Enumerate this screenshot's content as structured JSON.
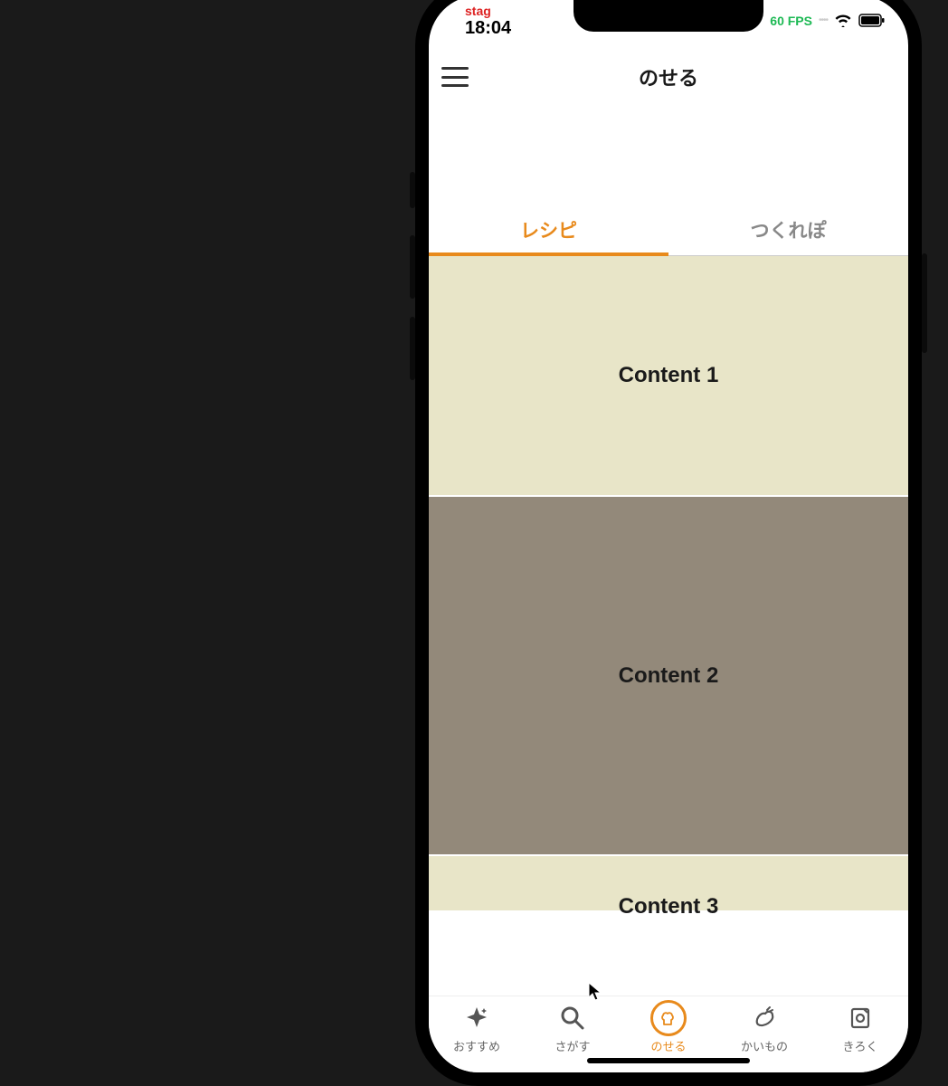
{
  "status": {
    "stag": "stag",
    "time": "18:04",
    "fps": "60 FPS"
  },
  "navbar": {
    "title": "のせる"
  },
  "tabs": {
    "recipe": "レシピ",
    "tsukurepo": "つくれぽ"
  },
  "content": {
    "row1": "Content 1",
    "row2": "Content 2",
    "row3": "Content 3"
  },
  "bottom_nav": {
    "osusume": "おすすめ",
    "sagasu": "さがす",
    "noseru": "のせる",
    "kaimono": "かいもの",
    "kiroku": "きろく"
  }
}
